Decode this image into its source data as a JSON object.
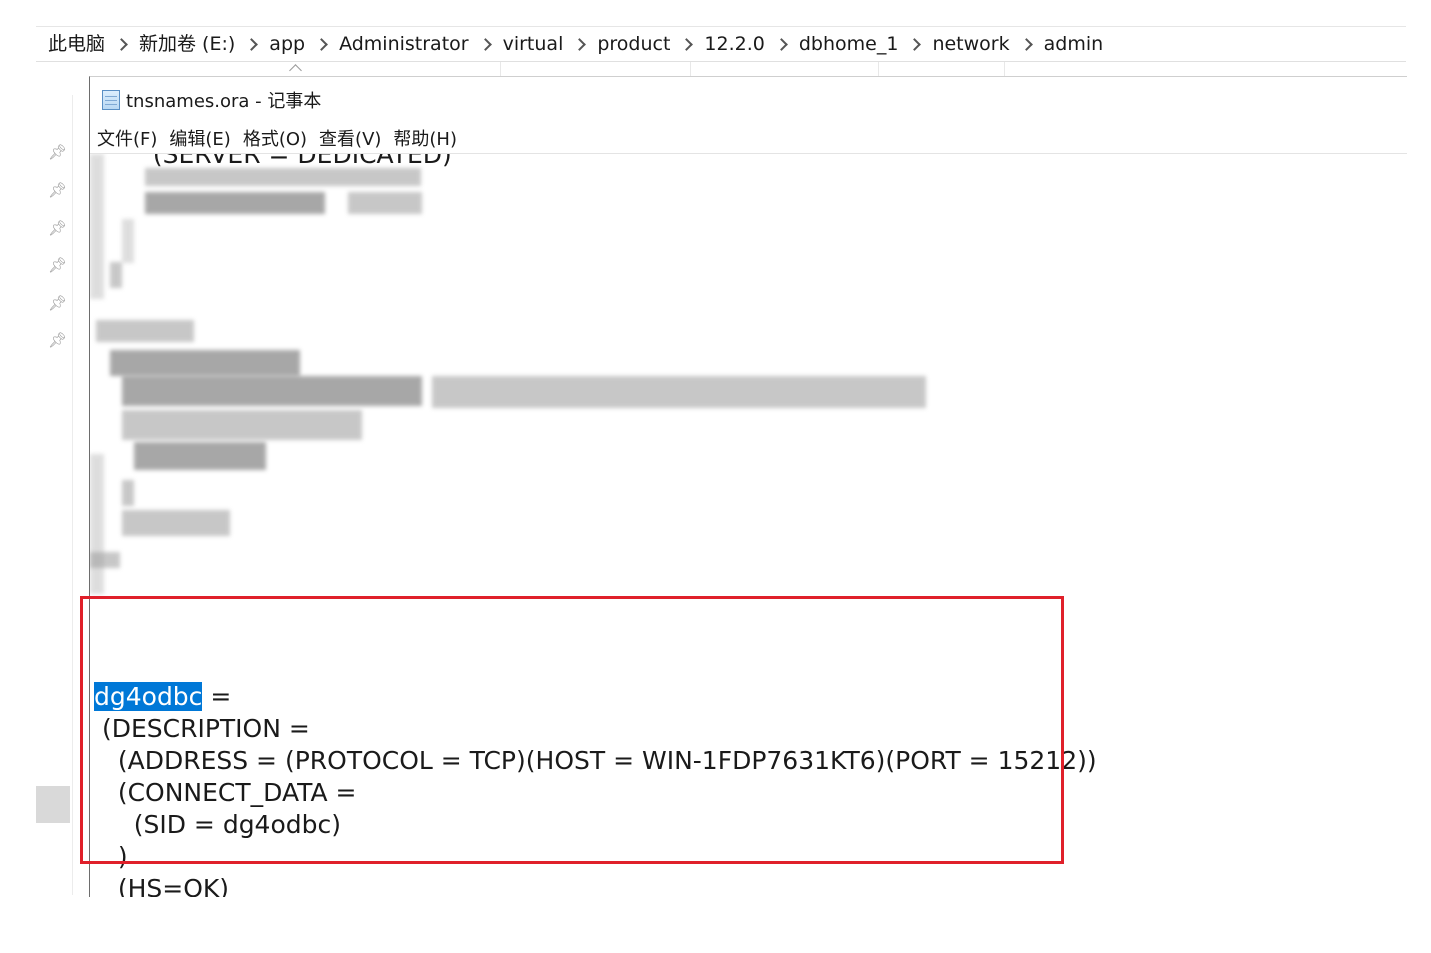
{
  "address_bar": {
    "crumbs": [
      "此电脑",
      "新加卷 (E:)",
      "app",
      "Administrator",
      "virtual",
      "product",
      "12.2.0",
      "dbhome_1",
      "network",
      "admin"
    ]
  },
  "notepad": {
    "title": "tnsnames.ora - 记事本",
    "menu": [
      "文件(F)",
      "编辑(E)",
      "格式(O)",
      "查看(V)",
      "帮助(H)"
    ],
    "clipped_top_line": "  (SERVER = DEDICATED)",
    "entry": {
      "name": "dg4odbc",
      "name_suffix": " =",
      "lines": [
        " (DESCRIPTION =",
        "   (ADDRESS = (PROTOCOL = TCP)(HOST = WIN-1FDP7631KT6)(PORT = 15212))",
        "   (CONNECT_DATA =",
        "     (SID = dg4odbc)",
        "   )",
        "   (HS=OK)",
        " )"
      ]
    }
  },
  "colors": {
    "selection": "#0078d7",
    "highlight_box": "#e0202a"
  }
}
